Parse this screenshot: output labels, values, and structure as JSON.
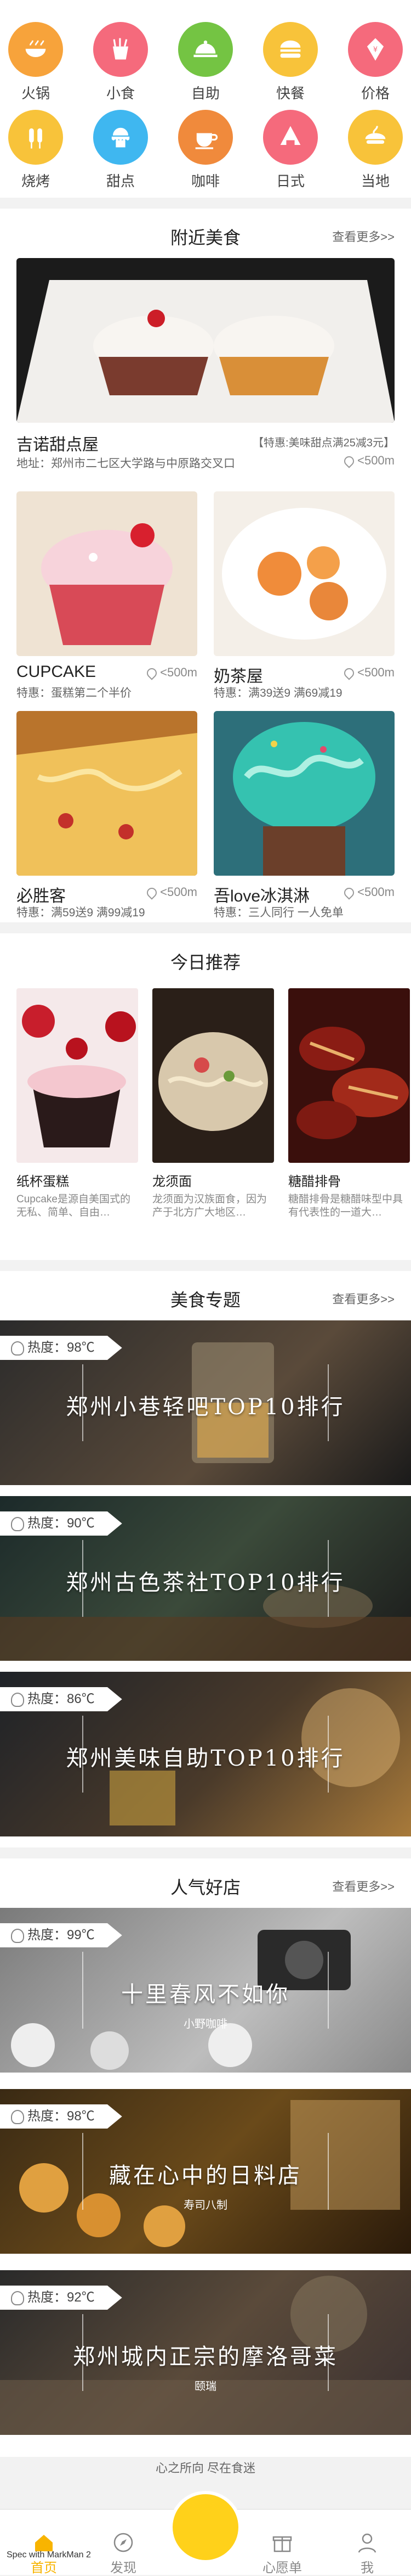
{
  "categories": [
    {
      "label": "火锅",
      "color": "#f7a33b",
      "icon": "hotpot-icon"
    },
    {
      "label": "小食",
      "color": "#f56a7c",
      "icon": "snack-icon"
    },
    {
      "label": "自助",
      "color": "#74c443",
      "icon": "buffet-icon"
    },
    {
      "label": "快餐",
      "color": "#f8c33a",
      "icon": "fastfood-icon"
    },
    {
      "label": "价格",
      "color": "#f56a7c",
      "icon": "price-icon"
    },
    {
      "label": "烧烤",
      "color": "#f8c33a",
      "icon": "bbq-icon"
    },
    {
      "label": "甜点",
      "color": "#3fb7f0",
      "icon": "dessert-icon"
    },
    {
      "label": "咖啡",
      "color": "#f08a3c",
      "icon": "coffee-icon"
    },
    {
      "label": "日式",
      "color": "#f56a7c",
      "icon": "sushi-icon"
    },
    {
      "label": "当地",
      "color": "#f8c33a",
      "icon": "local-icon"
    }
  ],
  "nearby": {
    "title": "附近美食",
    "more": "查看更多>>",
    "feature": {
      "name": "吉诺甜点屋",
      "promo": "【特惠:美味甜点满25减3元】",
      "address": "地址：郑州市二七区大学路与中原路交叉口",
      "distance": "<500m"
    },
    "items": [
      {
        "name": "CUPCAKE",
        "offer": "特惠：蛋糕第二个半价",
        "distance": "<500m"
      },
      {
        "name": "奶茶屋",
        "offer": "特惠：满39送9 满69减19",
        "distance": "<500m"
      },
      {
        "name": "必胜客",
        "offer": "特惠：满59送9 满99减19",
        "distance": "<500m"
      },
      {
        "name": "吾love冰淇淋",
        "offer": "特惠：三人同行 一人免单",
        "distance": "<500m"
      }
    ]
  },
  "recommend": {
    "title": "今日推荐",
    "items": [
      {
        "name": "纸杯蛋糕",
        "desc": "Cupcake是源自美国式的无私、简单、自由…"
      },
      {
        "name": "龙须面",
        "desc": "龙须面为汉族面食，因为产于北方广大地区…"
      },
      {
        "name": "糖醋排骨",
        "desc": "糖醋排骨是糖醋味型中具有代表性的一道大…"
      }
    ]
  },
  "topics": {
    "title": "美食专题",
    "more": "查看更多>>",
    "items": [
      {
        "heat": "热度：98℃",
        "title": "郑州小巷轻吧TOP10排行"
      },
      {
        "heat": "热度：90℃",
        "title": "郑州古色茶社TOP10排行"
      },
      {
        "heat": "热度：86℃",
        "title": "郑州美味自助TOP10排行"
      }
    ]
  },
  "popular": {
    "title": "人气好店",
    "more": "查看更多>>",
    "items": [
      {
        "heat": "热度：99℃",
        "title": "十里春风不如你",
        "sub": "小野咖啡"
      },
      {
        "heat": "热度：98℃",
        "title": "藏在心中的日料店",
        "sub": "寿司八制"
      },
      {
        "heat": "热度：92℃",
        "title": "郑州城内正宗的摩洛哥菜",
        "sub": "颐瑞"
      }
    ]
  },
  "slogan": "心之所向 尽在食迷",
  "nav": [
    {
      "label": "首页",
      "active": true
    },
    {
      "label": "发现"
    },
    {
      "label": "心愿单"
    },
    {
      "label": "我"
    }
  ],
  "watermark": "Spec with MarkMan 2"
}
